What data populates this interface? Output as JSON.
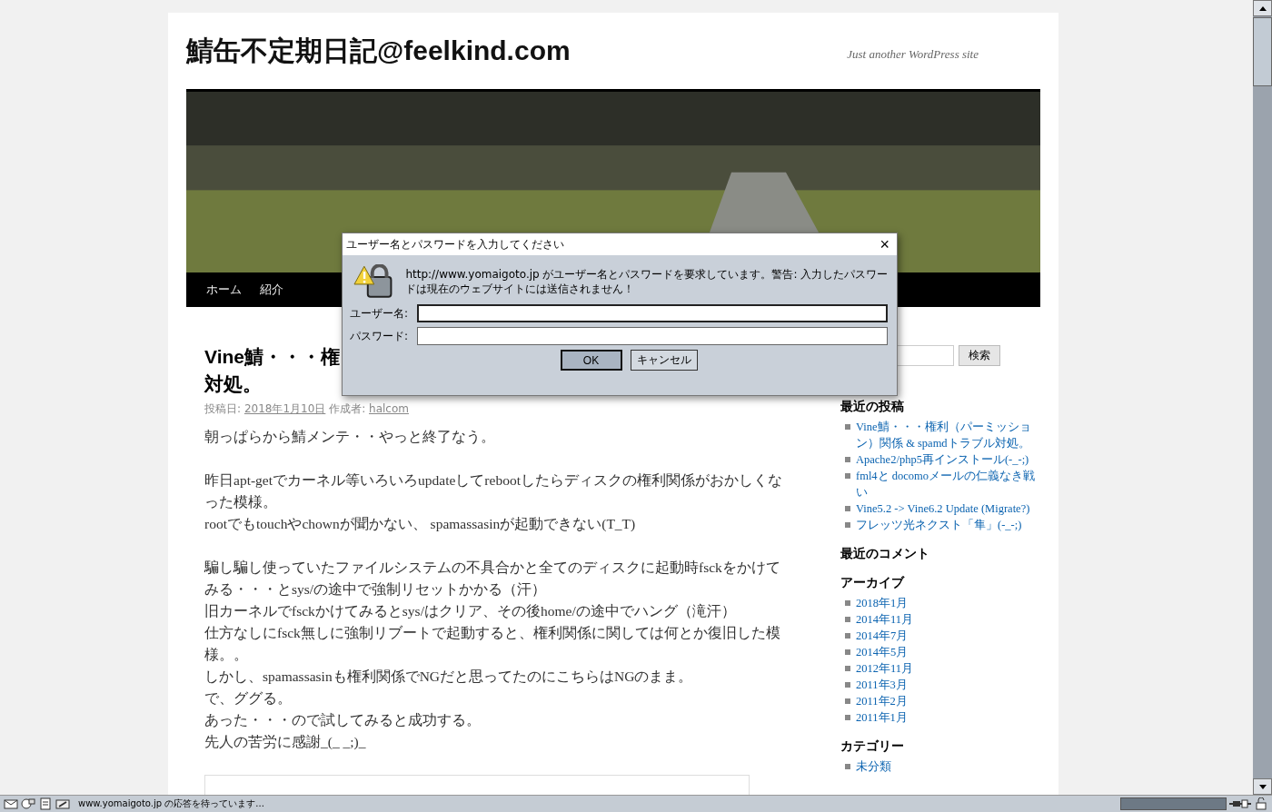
{
  "site": {
    "title": "鯖缶不定期日記@feelkind.com",
    "tagline": "Just another WordPress site"
  },
  "nav": [
    {
      "label": "ホーム"
    },
    {
      "label": "紹介"
    }
  ],
  "post": {
    "title_lines": [
      "Vine鯖・・・権",
      "対処。"
    ],
    "meta": {
      "posted_label": "投稿日:",
      "date": "2018年1月10日",
      "author_label": "作成者:",
      "author": "halcom"
    },
    "paragraphs": [
      [
        "朝っぱらから鯖メンテ・・やっと終了なう。"
      ],
      [
        "昨日apt-getでカーネル等いろいろupdateしてrebootしたらディスクの権利関係がおかしくなった模様。",
        "rootでもtouchやchownが聞かない、 spamassasinが起動できない(T_T)"
      ],
      [
        "騙し騙し使っていたファイルシステムの不具合かと全てのディスクに起動時fsckをかけてみる・・・とsys/の途中で強制リセットかかる（汗）",
        "旧カーネルでfsckかけてみるとsys/はクリア、その後home/の途中でハング（滝汗）",
        "仕方なしにfsck無しに強制リブートで起動すると、権利関係に関しては何とか復旧した模様。。",
        "しかし、spamassasinも権利関係でNGだと思ってたのにこちらはNGのまま。",
        "で、ググる。",
        "あった・・・ので試してみると成功する。",
        "先人の苦労に感謝_(_ _;)_"
      ]
    ]
  },
  "sidebar": {
    "search_button": "検索",
    "widgets": [
      {
        "heading": "最近の投稿",
        "items": [
          "Vine鯖・・・権利（パーミッション）関係 & spamdトラブル対処。",
          "Apache2/php5再インストール(-_-;)",
          "fml4と docomoメールの仁義なき戦い",
          "Vine5.2 -> Vine6.2 Update (Migrate?)",
          "フレッツ光ネクスト「隼」(-_-;)"
        ]
      },
      {
        "heading": "最近のコメント"
      },
      {
        "heading": "アーカイブ",
        "items": [
          "2018年1月",
          "2014年11月",
          "2014年7月",
          "2014年5月",
          "2012年11月",
          "2011年3月",
          "2011年2月",
          "2011年1月"
        ]
      },
      {
        "heading": "カテゴリー",
        "items": [
          "未分類"
        ]
      }
    ]
  },
  "dialog": {
    "title": "ユーザー名とパスワードを入力してください",
    "close": "×",
    "message": "http://www.yomaigoto.jp がユーザー名とパスワードを要求しています。警告: 入力したパスワードは現在のウェブサイトには送信されません！",
    "fields": [
      {
        "label": "ユーザー名:",
        "kind": "text"
      },
      {
        "label": "パスワード:",
        "kind": "password"
      }
    ],
    "buttons": [
      {
        "label": "OK",
        "default": true
      },
      {
        "label": "キャンセル",
        "default": false
      }
    ]
  },
  "status_bar": {
    "text": "www.yomaigoto.jp の応答を待っています...",
    "progress": {
      "level": 1
    }
  }
}
